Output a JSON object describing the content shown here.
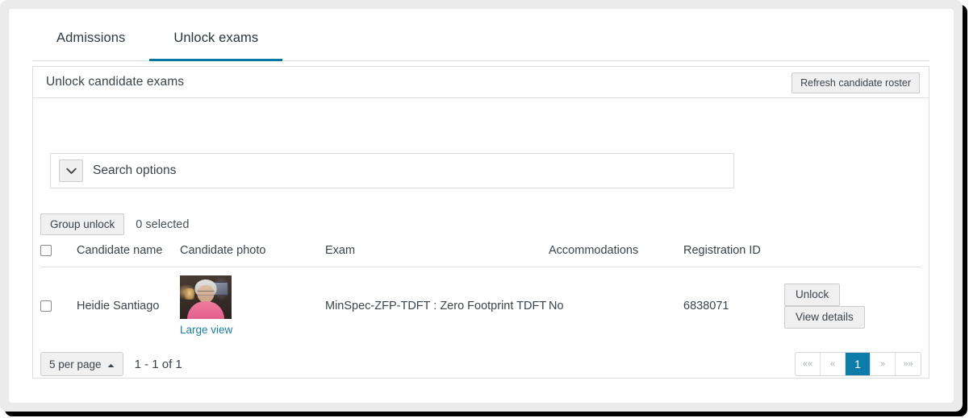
{
  "tabs": [
    {
      "label": "Admissions",
      "active": false
    },
    {
      "label": "Unlock exams",
      "active": true
    }
  ],
  "card": {
    "title": "Unlock candidate exams",
    "refresh_label": "Refresh candidate roster"
  },
  "search": {
    "label": "Search options",
    "toggle_icon": "chevron-down-icon"
  },
  "group_bar": {
    "group_unlock_label": "Group unlock",
    "selected_text": "0 selected"
  },
  "table": {
    "columns": [
      "Candidate name",
      "Candidate photo",
      "Exam",
      "Accommodations",
      "Registration ID"
    ],
    "rows": [
      {
        "name": "Heidie Santiago",
        "photo_link_label": "Large view",
        "exam": "MinSpec-ZFP-TDFT : Zero Footprint TDFT",
        "accommodations": "No",
        "registration_id": "6838071",
        "unlock_label": "Unlock",
        "details_label": "View details"
      }
    ]
  },
  "footer": {
    "per_page_label": "5 per page",
    "per_page_caret": "caret-up-icon",
    "range_text": "1 - 1 of 1",
    "pagination": [
      {
        "label": "««",
        "name": "page-first",
        "current": false
      },
      {
        "label": "«",
        "name": "page-prev",
        "current": false
      },
      {
        "label": "1",
        "name": "page-1",
        "current": true
      },
      {
        "label": "»",
        "name": "page-next",
        "current": false
      },
      {
        "label": "»»",
        "name": "page-last",
        "current": false
      }
    ]
  },
  "colors": {
    "accent": "#0077a3",
    "active_page": "#0d7ca8",
    "link": "#1a7fa8",
    "text": "#3b434b",
    "border": "#dddddd"
  }
}
